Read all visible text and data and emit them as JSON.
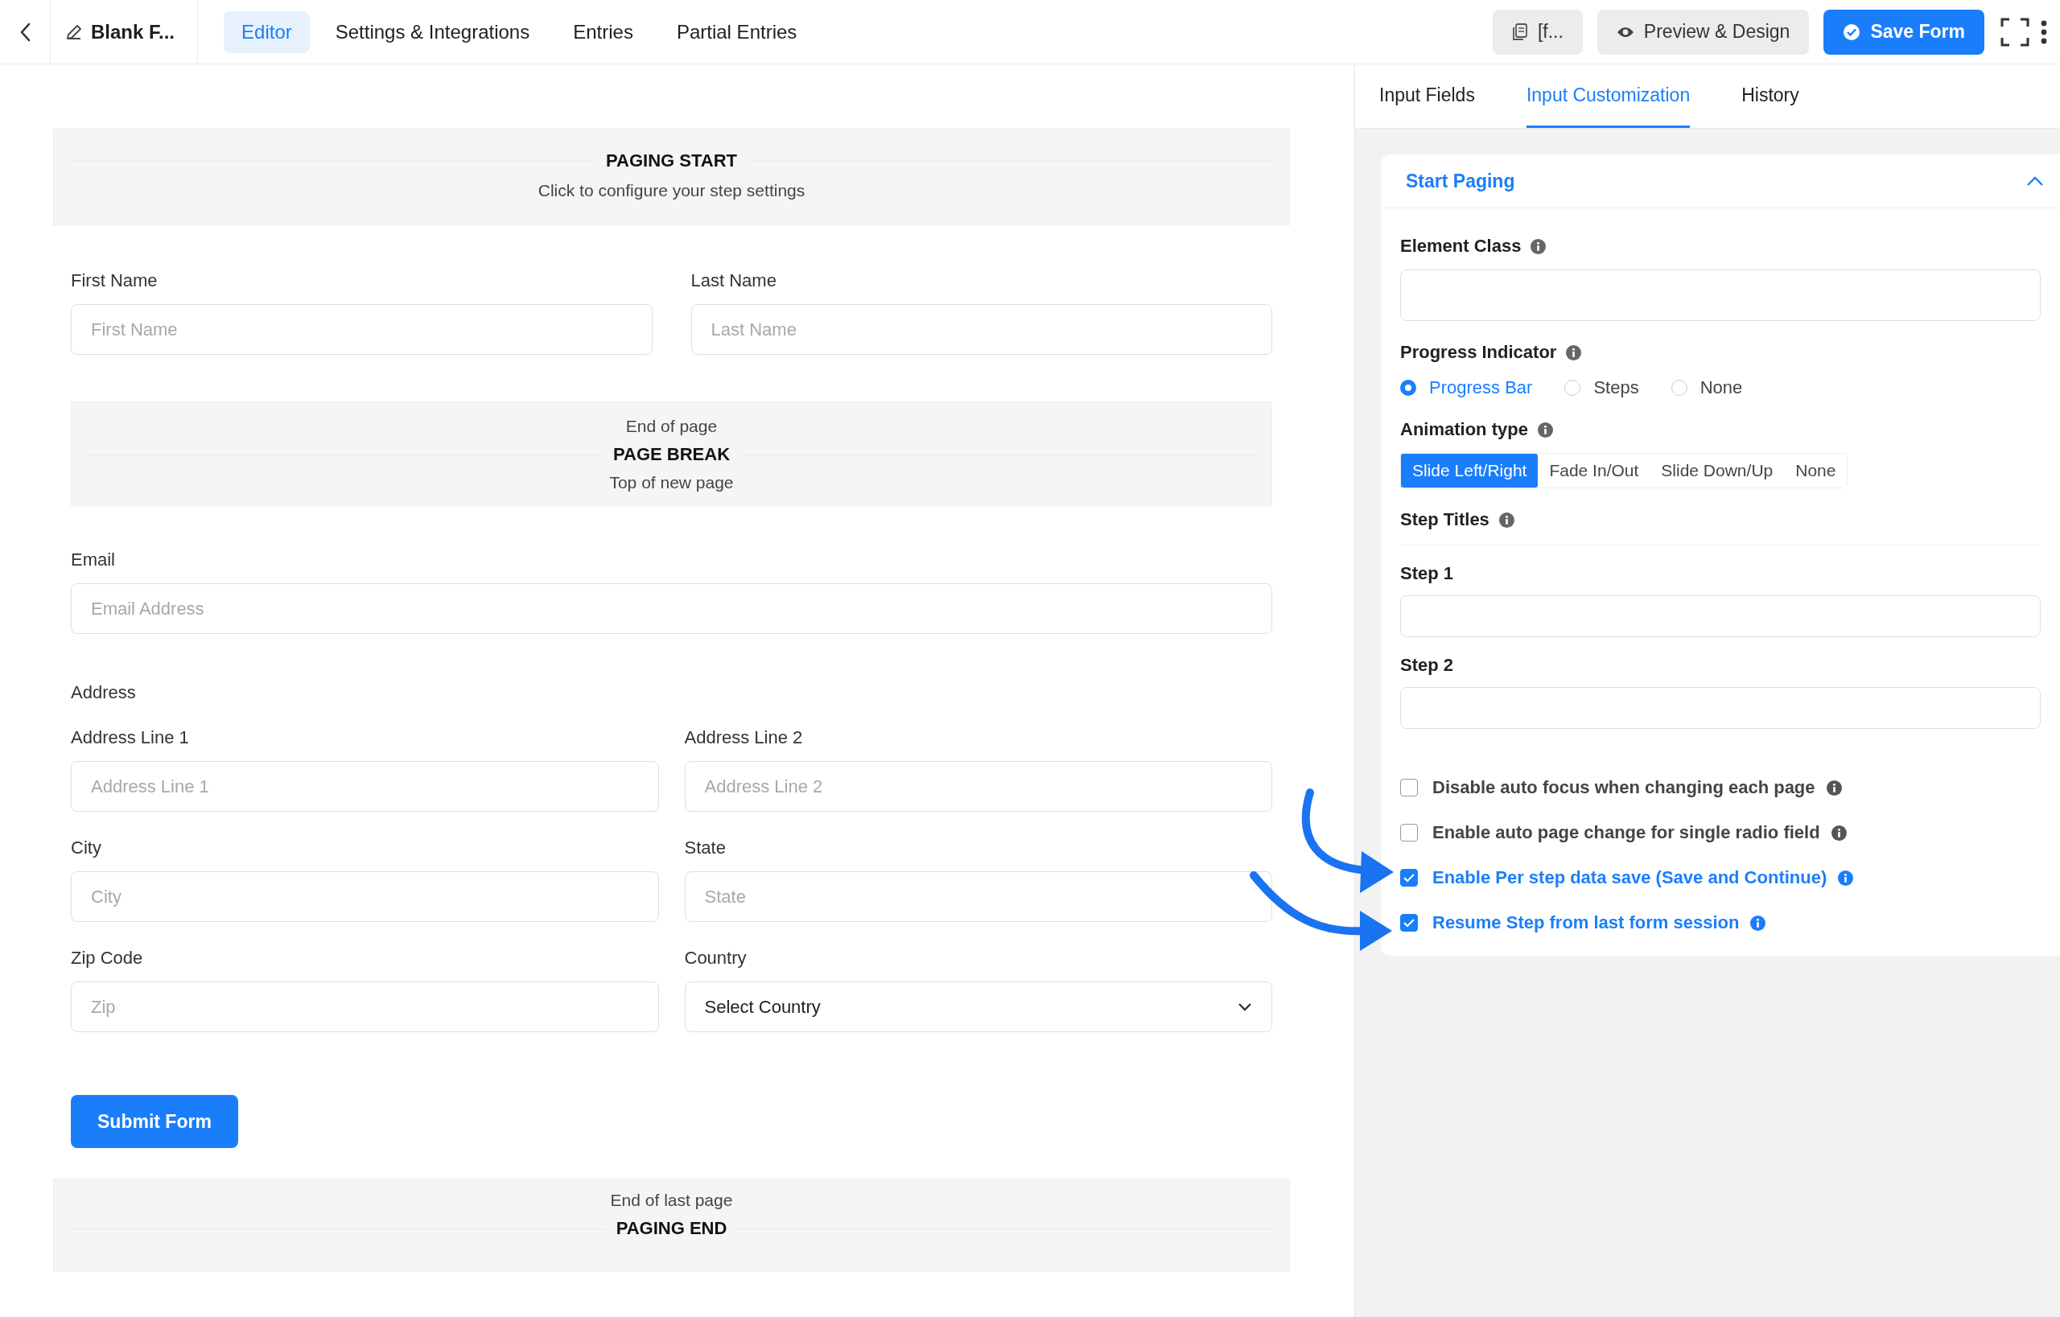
{
  "topbar": {
    "form_title": "Blank F...",
    "tabs": [
      {
        "label": "Editor",
        "selected": true
      },
      {
        "label": "Settings & Integrations",
        "selected": false
      },
      {
        "label": "Entries",
        "selected": false
      },
      {
        "label": "Partial Entries",
        "selected": false
      }
    ],
    "shortcode_button": "[f...",
    "preview_button": "Preview & Design",
    "save_button": "Save Form"
  },
  "canvas": {
    "paging_start": {
      "title": "PAGING START",
      "subtitle": "Click to configure your step settings"
    },
    "name_fields": [
      {
        "label": "First Name",
        "placeholder": "First Name"
      },
      {
        "label": "Last Name",
        "placeholder": "Last Name"
      }
    ],
    "page_break": {
      "above": "End of page",
      "title": "PAGE BREAK",
      "below": "Top of new page"
    },
    "email": {
      "label": "Email",
      "placeholder": "Email Address"
    },
    "address": {
      "label": "Address",
      "fields": [
        {
          "kind": "input",
          "label": "Address Line 1",
          "placeholder": "Address Line 1"
        },
        {
          "kind": "input",
          "label": "Address Line 2",
          "placeholder": "Address Line 2"
        },
        {
          "kind": "input",
          "label": "City",
          "placeholder": "City"
        },
        {
          "kind": "input",
          "label": "State",
          "placeholder": "State"
        },
        {
          "kind": "input",
          "label": "Zip Code",
          "placeholder": "Zip"
        },
        {
          "kind": "select",
          "label": "Country",
          "value": "Select Country"
        }
      ]
    },
    "submit_button": "Submit Form",
    "paging_end": {
      "above": "End of last page",
      "title": "PAGING END"
    }
  },
  "sidebar": {
    "tabs": [
      {
        "label": "Input Fields",
        "selected": false
      },
      {
        "label": "Input Customization",
        "selected": true
      },
      {
        "label": "History",
        "selected": false
      }
    ],
    "panel": {
      "title": "Start Paging",
      "expanded": true,
      "element_class": {
        "label": "Element Class"
      },
      "progress_indicator": {
        "label": "Progress Indicator",
        "options": [
          {
            "label": "Progress Bar",
            "selected": true
          },
          {
            "label": "Steps",
            "selected": false
          },
          {
            "label": "None",
            "selected": false
          }
        ]
      },
      "animation_type": {
        "label": "Animation type",
        "options": [
          {
            "label": "Slide Left/Right",
            "selected": true
          },
          {
            "label": "Fade In/Out",
            "selected": false
          },
          {
            "label": "Slide Down/Up",
            "selected": false
          },
          {
            "label": "None",
            "selected": false
          }
        ]
      },
      "step_titles": {
        "label": "Step Titles",
        "steps": [
          {
            "label": "Step 1"
          },
          {
            "label": "Step 2"
          }
        ]
      },
      "options": [
        {
          "label": "Disable auto focus when changing each page",
          "checked": false
        },
        {
          "label": "Enable auto page change for single radio field",
          "checked": false
        },
        {
          "label": "Enable Per step data save (Save and Continue)",
          "checked": true
        },
        {
          "label": "Resume Step from last form session",
          "checked": true
        }
      ]
    }
  }
}
